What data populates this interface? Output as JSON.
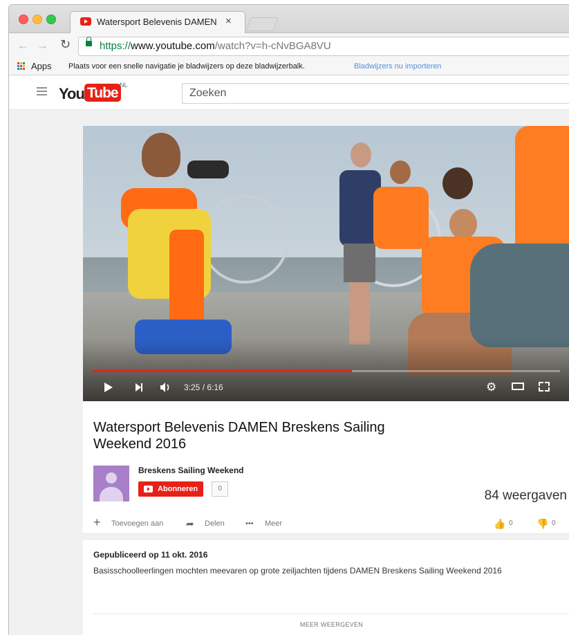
{
  "browser": {
    "tab_title": "Watersport Belevenis DAMEN",
    "tab_close": "×",
    "url": {
      "scheme": "https://",
      "host": "www.youtube.com",
      "path": "/watch?v=h-cNvBGA8VU"
    },
    "bookmarks": {
      "apps_label": "Apps",
      "hint": "Plaats voor een snelle navigatie je bladwijzers op deze bladwijzerbalk.",
      "import_link": "Bladwijzers nu importeren"
    }
  },
  "youtube": {
    "logo_you": "You",
    "logo_tube": "Tube",
    "country": "NL",
    "search_placeholder": "Zoeken"
  },
  "player": {
    "time": "3:25 / 6:16",
    "progress": 0.554
  },
  "video": {
    "title": "Watersport Belevenis DAMEN Breskens Sailing Weekend 2016",
    "channel": "Breskens Sailing Weekend",
    "subscribe_label": "Abonneren",
    "subscriber_count": "0",
    "views": "84 weergaven",
    "actions": {
      "add_to": "Toevoegen aan",
      "share": "Delen",
      "more": "Meer"
    },
    "likes": "0",
    "dislikes": "0"
  },
  "description": {
    "published": "Gepubliceerd op 11 okt. 2016",
    "text": "Basisschoolleerlingen mochten meevaren op grote zeiljachten tijdens DAMEN Breskens Sailing Weekend 2016",
    "show_more": "MEER WEERGEVEN"
  },
  "colors": {
    "youtube_red": "#e62117",
    "secure_green": "#0b8043",
    "link_blue": "#5a8fd6"
  }
}
